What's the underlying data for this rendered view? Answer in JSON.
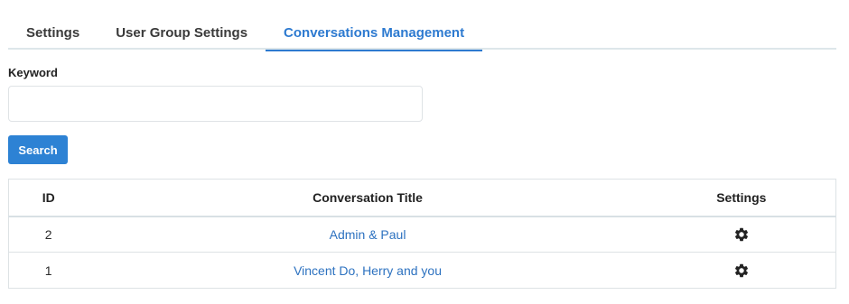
{
  "tabs": [
    {
      "label": "Settings",
      "active": false
    },
    {
      "label": "User Group Settings",
      "active": false
    },
    {
      "label": "Conversations Management",
      "active": true
    }
  ],
  "search": {
    "keyword_label": "Keyword",
    "keyword_value": "",
    "keyword_placeholder": "",
    "button_label": "Search"
  },
  "table": {
    "headers": {
      "id": "ID",
      "title": "Conversation Title",
      "settings": "Settings"
    },
    "rows": [
      {
        "id": "2",
        "title": "Admin & Paul",
        "settings_icon": "gear-icon"
      },
      {
        "id": "1",
        "title": "Vincent Do, Herry and you",
        "settings_icon": "gear-icon"
      }
    ]
  },
  "colors": {
    "accent": "#2d7ad0",
    "button": "#2d82d4",
    "link": "#2d72c0"
  }
}
